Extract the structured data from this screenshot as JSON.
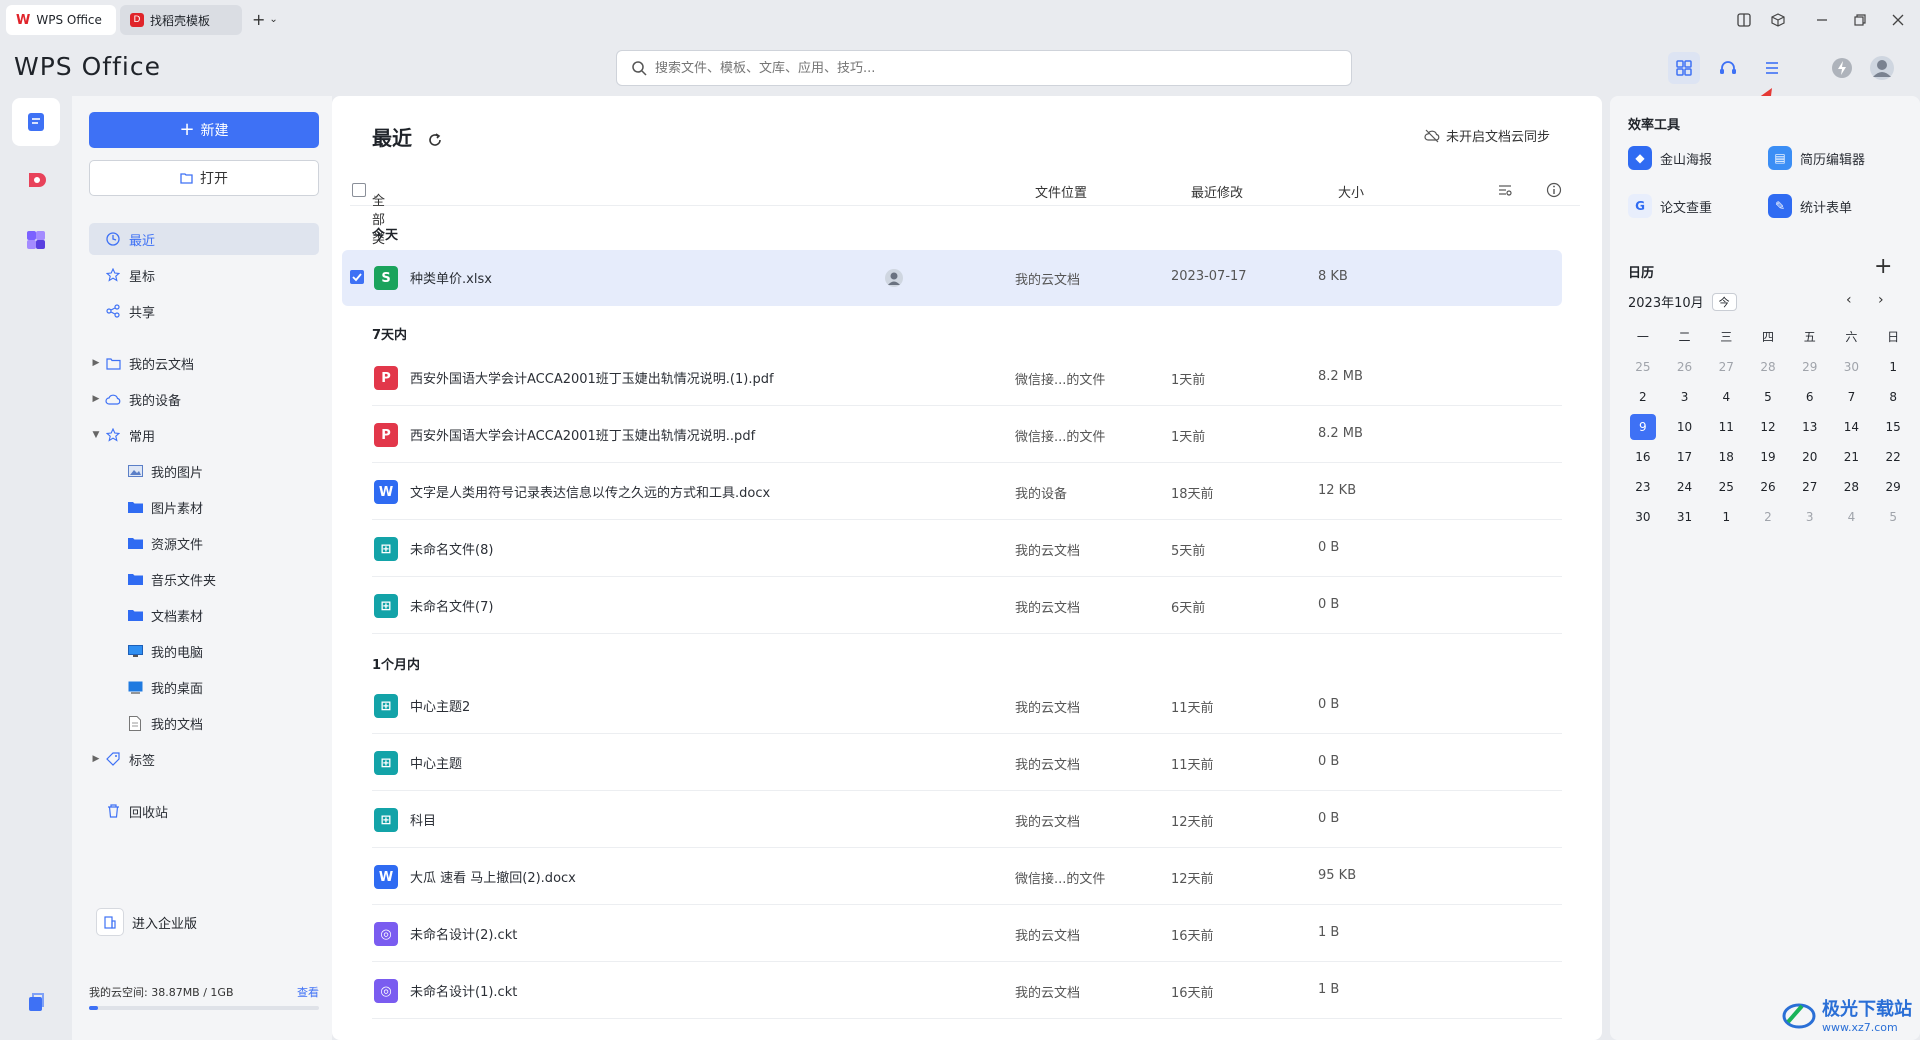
{
  "titlebar": {
    "tabs": [
      {
        "label": "WPS Office"
      },
      {
        "label": "找稻壳模板"
      }
    ]
  },
  "header": {
    "brand": "WPS Office",
    "search_placeholder": "搜索文件、模板、文库、应用、技巧..."
  },
  "nav": {
    "new_label": "新建",
    "open_label": "打开",
    "items": [
      {
        "label": "最近"
      },
      {
        "label": "星标"
      },
      {
        "label": "共享"
      },
      {
        "label": "我的云文档"
      },
      {
        "label": "我的设备"
      },
      {
        "label": "常用"
      },
      {
        "label": "我的图片"
      },
      {
        "label": "图片素材"
      },
      {
        "label": "资源文件"
      },
      {
        "label": "音乐文件夹"
      },
      {
        "label": "文档素材"
      },
      {
        "label": "我的电脑"
      },
      {
        "label": "我的桌面"
      },
      {
        "label": "我的文档"
      },
      {
        "label": "标签"
      },
      {
        "label": "回收站"
      }
    ],
    "enterprise_label": "进入企业版",
    "quota_label": "我的云空间: 38.87MB / 1GB",
    "quota_link": "查看",
    "quota_fraction": 0.04
  },
  "main": {
    "title": "最近",
    "sync_label": "未开启文档云同步",
    "columns": {
      "type": "全部类型",
      "location": "文件位置",
      "modified": "最近修改",
      "size": "大小"
    },
    "groups": [
      {
        "label": "今天"
      },
      {
        "label": "7天内"
      },
      {
        "label": "1个月内"
      }
    ],
    "files": [
      {
        "name": "种类单价.xlsx",
        "location": "我的云文档",
        "modified": "2023-07-17",
        "size": "8 KB",
        "icon_letter": "S"
      },
      {
        "name": "西安外国语大学会计ACCA2001班丁玉婕出轨情况说明.(1).pdf",
        "location": "微信接...的文件",
        "modified": "1天前",
        "size": "8.2 MB",
        "icon_letter": "P"
      },
      {
        "name": "西安外国语大学会计ACCA2001班丁玉婕出轨情况说明..pdf",
        "location": "微信接...的文件",
        "modified": "1天前",
        "size": "8.2 MB",
        "icon_letter": "P"
      },
      {
        "name": "文字是人类用符号记录表达信息以传之久远的方式和工具.docx",
        "location": "我的设备",
        "modified": "18天前",
        "size": "12 KB",
        "icon_letter": "W"
      },
      {
        "name": "未命名文件(8)",
        "location": "我的云文档",
        "modified": "5天前",
        "size": "0 B",
        "icon_letter": "⊞"
      },
      {
        "name": "未命名文件(7)",
        "location": "我的云文档",
        "modified": "6天前",
        "size": "0 B",
        "icon_letter": "⊞"
      },
      {
        "name": "中心主题2",
        "location": "我的云文档",
        "modified": "11天前",
        "size": "0 B",
        "icon_letter": "⊞"
      },
      {
        "name": "中心主题",
        "location": "我的云文档",
        "modified": "11天前",
        "size": "0 B",
        "icon_letter": "⊞"
      },
      {
        "name": "科目",
        "location": "我的云文档",
        "modified": "12天前",
        "size": "0 B",
        "icon_letter": "⊞"
      },
      {
        "name": "大瓜 速看 马上撤回(2).docx",
        "location": "微信接...的文件",
        "modified": "12天前",
        "size": "95 KB",
        "icon_letter": "W"
      },
      {
        "name": "未命名设计(2).ckt",
        "location": "我的云文档",
        "modified": "16天前",
        "size": "1 B",
        "icon_letter": "◎"
      },
      {
        "name": "未命名设计(1).ckt",
        "location": "我的云文档",
        "modified": "16天前",
        "size": "1 B",
        "icon_letter": "◎"
      }
    ]
  },
  "right": {
    "tools_title": "效率工具",
    "tools": [
      {
        "label": "金山海报"
      },
      {
        "label": "简历编辑器"
      },
      {
        "label": "论文查重"
      },
      {
        "label": "统计表单"
      }
    ],
    "calendar_title": "日历",
    "month_label": "2023年10月",
    "today_label": "今",
    "weekdays": [
      "一",
      "二",
      "三",
      "四",
      "五",
      "六",
      "日"
    ],
    "days": [
      "25",
      "26",
      "27",
      "28",
      "29",
      "30",
      "1",
      "2",
      "3",
      "4",
      "5",
      "6",
      "7",
      "8",
      "9",
      "10",
      "11",
      "12",
      "13",
      "14",
      "15",
      "16",
      "17",
      "18",
      "19",
      "20",
      "21",
      "22",
      "23",
      "24",
      "25",
      "26",
      "27",
      "28",
      "29",
      "30",
      "31",
      "1",
      "2",
      "3",
      "4",
      "5"
    ]
  },
  "watermark": {
    "name": "极光下载站",
    "url": "www.xz7.com"
  },
  "colors": {
    "accent": "#3e71f5",
    "selected_row": "#e6ecfb",
    "annotation_arrow": "#e53935"
  }
}
